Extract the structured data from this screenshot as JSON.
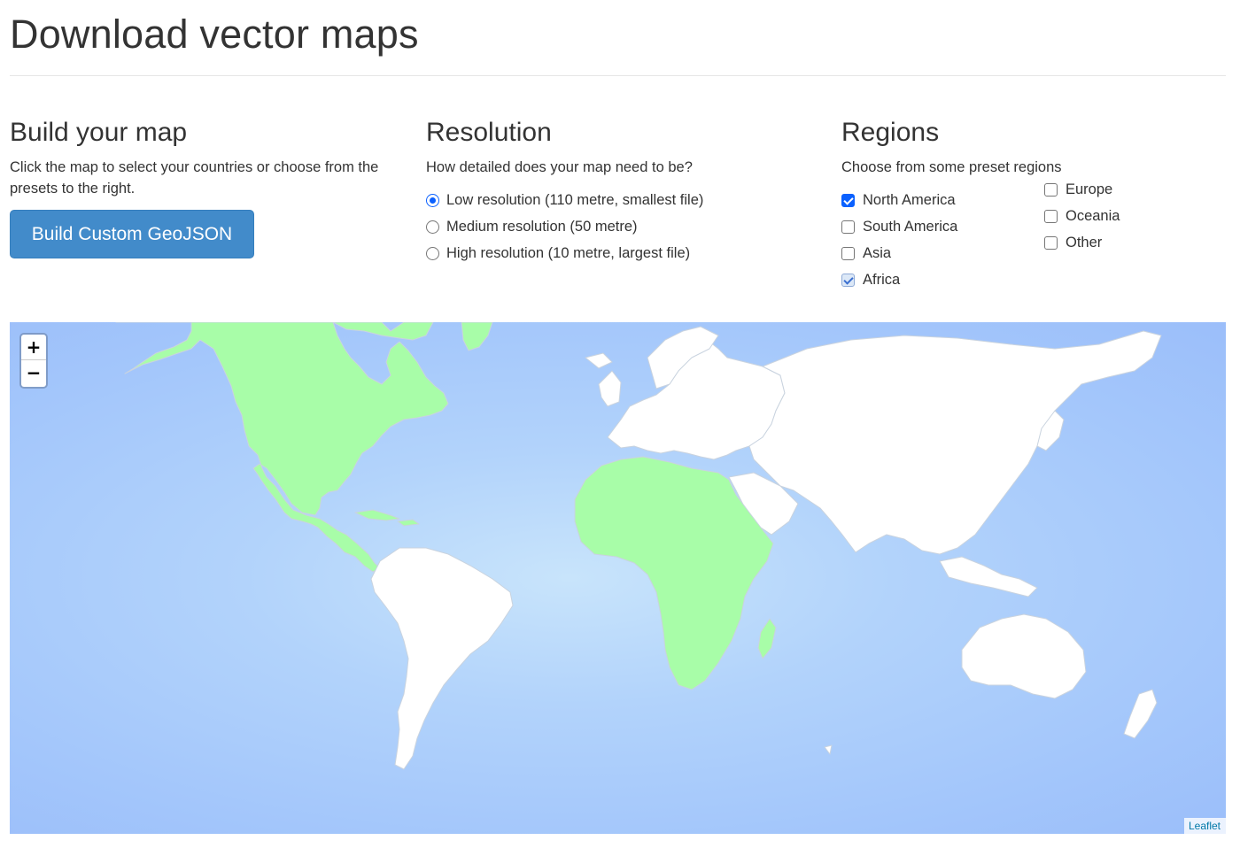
{
  "page": {
    "title": "Download vector maps"
  },
  "build": {
    "heading": "Build your map",
    "description": "Click the map to select your countries or choose from the presets to the right.",
    "button_label": "Build Custom GeoJSON"
  },
  "resolution": {
    "heading": "Resolution",
    "description": "How detailed does your map need to be?",
    "options": [
      {
        "label": "Low resolution (110 metre, smallest file)",
        "selected": true
      },
      {
        "label": "Medium resolution (50 metre)",
        "selected": false
      },
      {
        "label": "High resolution (10 metre, largest file)",
        "selected": false
      }
    ]
  },
  "regions": {
    "heading": "Regions",
    "description": "Choose from some preset regions",
    "items": [
      {
        "label": "North America",
        "checked": true
      },
      {
        "label": "South America",
        "checked": false
      },
      {
        "label": "Asia",
        "checked": false
      },
      {
        "label": "Africa",
        "checked": true
      },
      {
        "label": "Europe",
        "checked": false
      },
      {
        "label": "Oceania",
        "checked": false
      },
      {
        "label": "Other",
        "checked": false
      }
    ]
  },
  "map": {
    "zoom_in": "+",
    "zoom_out": "−",
    "attribution": "Leaflet",
    "colors": {
      "ocean": "#a3c6fb",
      "land": "#ffffff",
      "selected": "#a8fda8",
      "border": "#c9d3df"
    }
  }
}
